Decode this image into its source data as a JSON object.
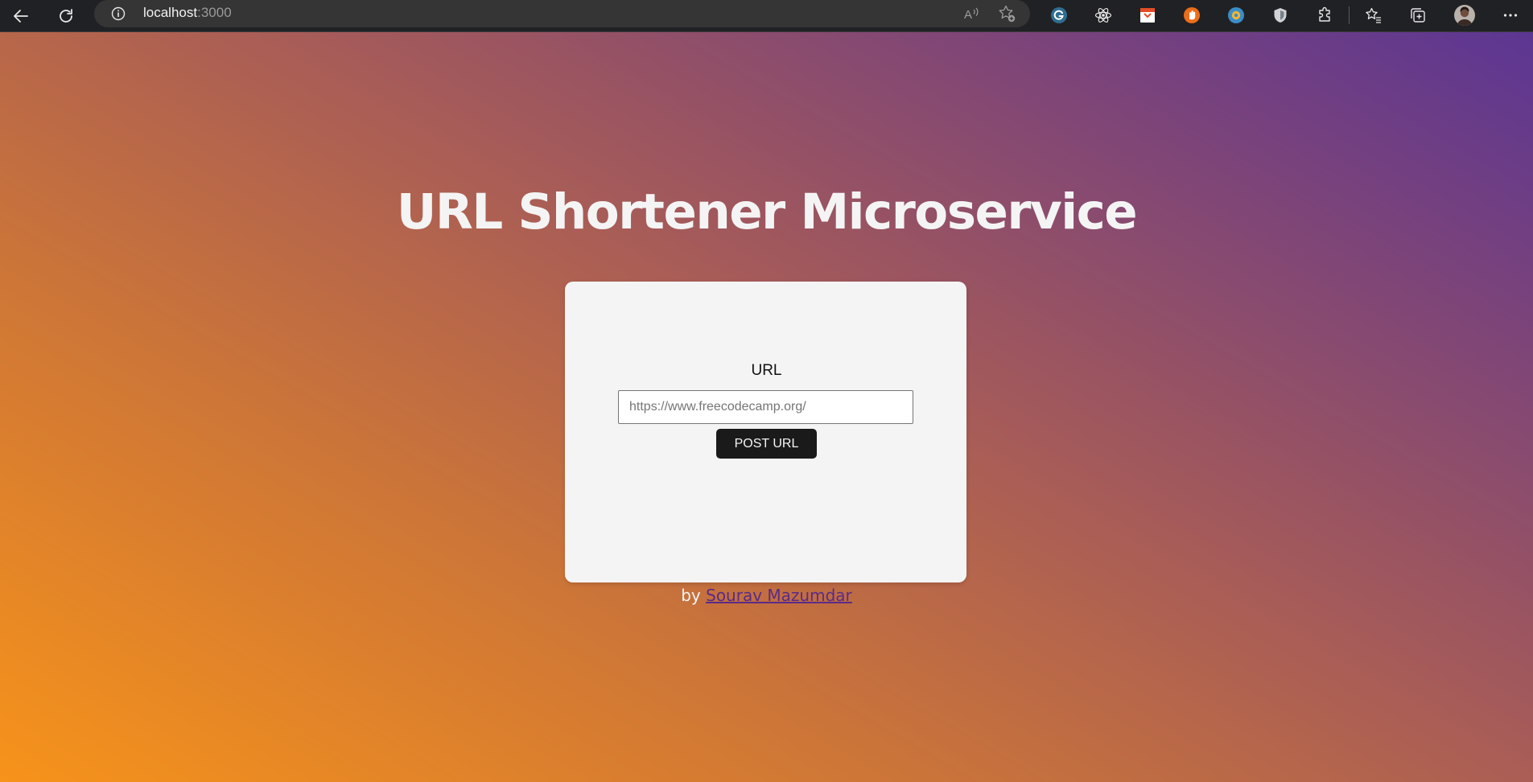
{
  "browser": {
    "url_host": "localhost",
    "url_port": ":3000"
  },
  "page": {
    "title": "URL Shortener Microservice",
    "form": {
      "label": "URL",
      "input_placeholder": "https://www.freecodecamp.org/",
      "input_value": "",
      "submit_label": "POST URL"
    },
    "footer": {
      "prefix": "by",
      "author_name": "Sourav Mazumdar"
    }
  },
  "colors": {
    "gradient_start": "#f7931a",
    "gradient_end": "#5c3693",
    "card_bg": "#f4f4f4",
    "button_bg": "#1a1a1a",
    "link": "#5a2b86"
  },
  "icons": {
    "toolbar": [
      "back-icon",
      "refresh-icon",
      "site-info-icon",
      "read-aloud-icon",
      "add-favorite-icon",
      "grammarly-icon",
      "react-devtools-icon",
      "extension-icon",
      "extension-icon",
      "extension-icon",
      "extension-icon",
      "extensions-icon",
      "favorites-icon",
      "collections-icon",
      "profile-avatar",
      "more-icon"
    ]
  }
}
